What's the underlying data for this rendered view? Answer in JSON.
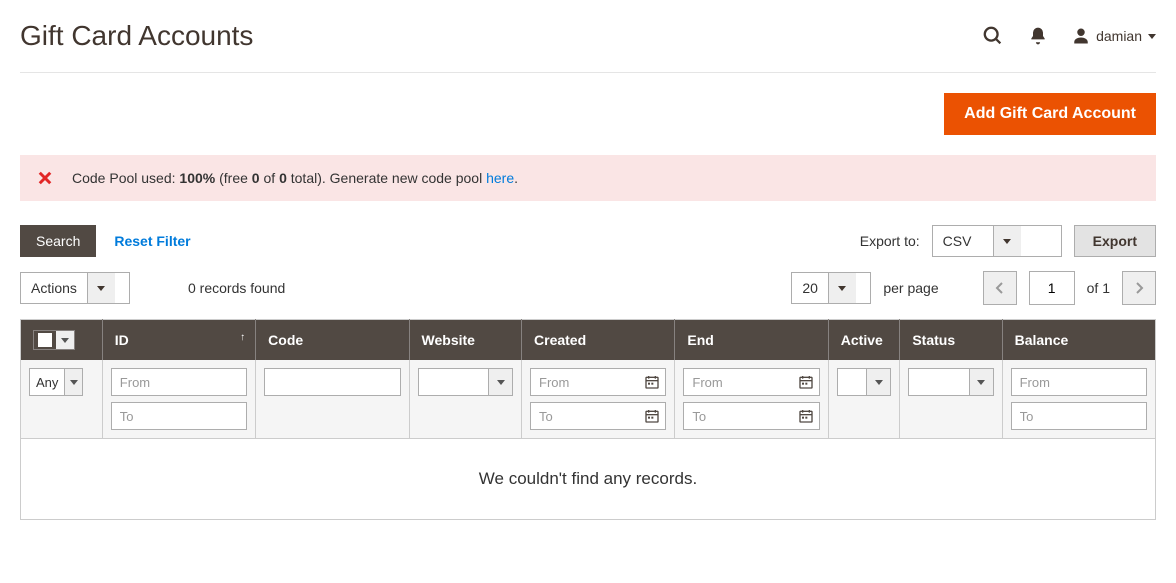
{
  "header": {
    "title": "Gift Card Accounts",
    "username": "damian"
  },
  "actionBar": {
    "addLabel": "Add Gift Card Account"
  },
  "message": {
    "pre": "Code Pool used: ",
    "percent": "100%",
    "mid1": " (free ",
    "free": "0",
    "mid2": " of ",
    "total": "0",
    "tail": " total). Generate new code pool ",
    "link": "here",
    "dot": "."
  },
  "toolbar": {
    "searchLabel": "Search",
    "resetLabel": "Reset Filter",
    "exportToLabel": "Export to:",
    "exportFormat": "CSV",
    "exportBtn": "Export"
  },
  "toolbar2": {
    "actionsLabel": "Actions",
    "recordsFound": "0 records found",
    "perPageValue": "20",
    "perPageLabel": "per page",
    "page": "1",
    "ofTotal": "of 1"
  },
  "columns": {
    "id": "ID",
    "code": "Code",
    "website": "Website",
    "created": "Created",
    "end": "End",
    "active": "Active",
    "status": "Status",
    "balance": "Balance"
  },
  "filters": {
    "any": "Any",
    "from": "From",
    "to": "To"
  },
  "empty": "We couldn't find any records."
}
